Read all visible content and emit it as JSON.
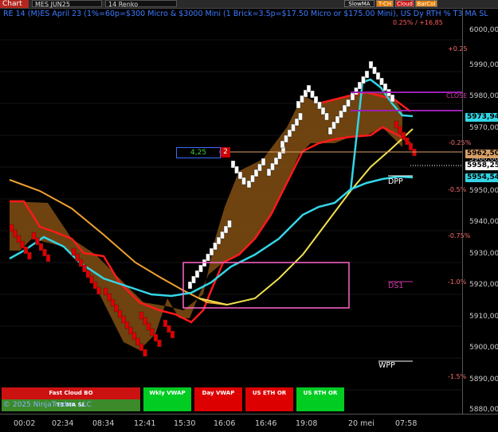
{
  "toolbar": {
    "chart_tab": "Chart",
    "instrument": "MES JUN25",
    "bar_type": "14 Renko",
    "buttons": [
      {
        "label": "SlowMA",
        "color": "#1c1c1c"
      },
      {
        "label": "T-CH",
        "color": "#e67e00"
      },
      {
        "label": "Cloud",
        "color": "#cc1111"
      },
      {
        "label": "BarCol",
        "color": "#e67e00"
      }
    ]
  },
  "title": {
    "text": "RE 14 (M)ES April 23 (1%=60p=$300 Micro & $3000 Mini  (1 Brick=3.5p=$17.50 Micro or $175.00 Mini), US Dy RTH %  T3 MA SL",
    "top_right": "0.25% / +16,85"
  },
  "price_axis": {
    "labels": [
      "6000,00",
      "5990,00",
      "5980,00",
      "5970,00",
      "5960,00",
      "5950,00",
      "5940,00",
      "5930,00",
      "5920,00",
      "5910,00",
      "5900,00",
      "5890,00",
      "5880,00"
    ],
    "tags": [
      {
        "value": "5973,94",
        "bg": "#33d6e6"
      },
      {
        "value": "5962,50",
        "bg": "#d9a066"
      },
      {
        "value": "5958,25",
        "bg": "#ffffff"
      },
      {
        "value": "5954,54",
        "bg": "#33d6e6"
      }
    ]
  },
  "percent_labels": [
    {
      "text": "+0.25",
      "color": "#ff6b6b"
    },
    {
      "text": "CLOSE",
      "color": "#d13aa6"
    },
    {
      "text": "-0.25%",
      "color": "#ff6b6b"
    },
    {
      "text": "-0.5%",
      "color": "#ff6b6b"
    },
    {
      "text": "-0.75%",
      "color": "#ff6b6b"
    },
    {
      "text": "-1.0%",
      "color": "#ff6b6b"
    },
    {
      "text": "-1.5%",
      "color": "#ff6b6b"
    }
  ],
  "pivots": {
    "dpp": "DPP",
    "ds1": "DS1",
    "wpp": "WPP"
  },
  "brick_info": {
    "value": "4,25",
    "count": "2"
  },
  "time_axis": [
    "00:02",
    "02:34",
    "08:34",
    "12:41",
    "15:30",
    "16:06",
    "16:46",
    "19:08",
    "20 mei",
    "07:58"
  ],
  "status_panel": {
    "fast_cloud": "Fast Cloud BO",
    "t3_ma": "T3 MA SL",
    "wkly_vwap": "Wkly VWAP",
    "day_vwap": "Day VWAP",
    "us_eth_or": "US ETH OR",
    "us_rth_or": "US RTH OR"
  },
  "copyright": "© 2025 NinjaTrader, LLC",
  "colors": {
    "bull": "#ffffff",
    "bear": "#e00000",
    "cloud": "#7a4a12",
    "cyan_ma": "#33d6e6",
    "yellow_ma": "#f0e050",
    "orange_ma": "#f0a030"
  }
}
